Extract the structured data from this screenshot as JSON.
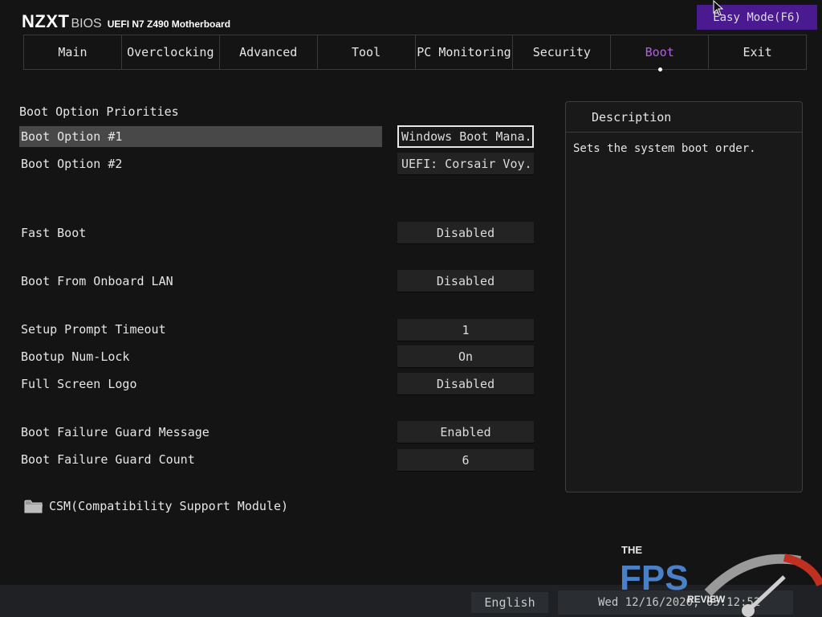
{
  "header": {
    "brand": "NZXT",
    "bios_label": "BIOS",
    "model": "UEFI N7 Z490 Motherboard",
    "easy_mode": "Easy Mode(F6)"
  },
  "tabs": [
    {
      "label": "Main"
    },
    {
      "label": "Overclocking"
    },
    {
      "label": "Advanced"
    },
    {
      "label": "Tool"
    },
    {
      "label": "PC Monitoring"
    },
    {
      "label": "Security"
    },
    {
      "label": "Boot",
      "active": true
    },
    {
      "label": "Exit"
    }
  ],
  "boot": {
    "section_title": "Boot Option Priorities",
    "settings": [
      {
        "label": "Boot Option #1",
        "value": "Windows Boot Mana..."
      },
      {
        "label": "Boot Option #2",
        "value": "UEFI: Corsair Voy..."
      },
      {
        "label": "Fast Boot",
        "value": "Disabled"
      },
      {
        "label": "Boot From Onboard LAN",
        "value": "Disabled"
      },
      {
        "label": "Setup Prompt Timeout",
        "value": "1"
      },
      {
        "label": "Bootup Num-Lock",
        "value": "On"
      },
      {
        "label": "Full Screen Logo",
        "value": "Disabled"
      },
      {
        "label": "Boot Failure Guard Message",
        "value": "Enabled"
      },
      {
        "label": "Boot Failure Guard Count",
        "value": "6"
      }
    ],
    "csm_label": "CSM(Compatibility Support Module)"
  },
  "description": {
    "title": "Description",
    "text": "Sets the system boot order."
  },
  "footer": {
    "language": "English",
    "datetime": "Wed 12/16/2020, 05:12:52"
  },
  "watermark": {
    "the": "THE",
    "fps": "FPS",
    "review": "REVIEW"
  },
  "colors": {
    "accent_purple": "#b060e0",
    "easy_mode_bg": "#4a1a90",
    "selected_row": "#484848"
  },
  "icons": [
    "folder-icon",
    "mouse-cursor-icon"
  ]
}
